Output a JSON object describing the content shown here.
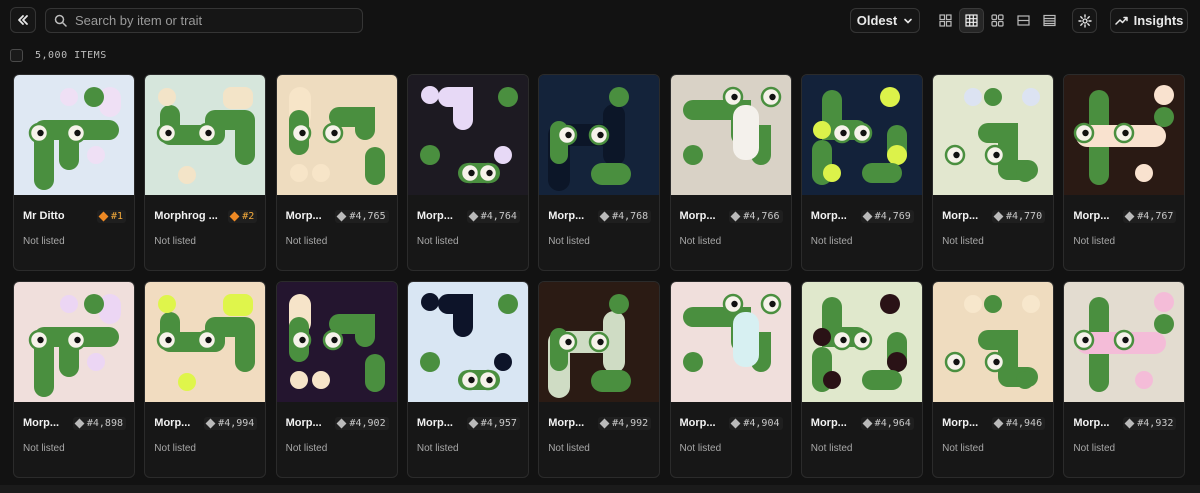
{
  "toolbar": {
    "search_placeholder": "Search by item or trait",
    "sort_label": "Oldest",
    "insights_label": "Insights",
    "view_modes": [
      "grid-small-icon",
      "grid-medium-icon",
      "grid-large-icon",
      "list-icon",
      "table-icon"
    ],
    "active_view": 1
  },
  "item_count": "5,000 ITEMS",
  "colors": {
    "accent_orange": "#f08a24",
    "frog_green": "#4a8f3f",
    "background": "#121212"
  },
  "items": [
    {
      "name": "Mr Ditto",
      "rank": "#1",
      "status": "Not listed",
      "top": true,
      "bg": "#dfe8f3",
      "accent": "#efe0f5"
    },
    {
      "name": "Morphrog ...",
      "rank": "#2",
      "status": "Not listed",
      "top": true,
      "bg": "#d6e6dc",
      "accent": "#f3e4c8"
    },
    {
      "name": "Morp...",
      "rank": "#4,765",
      "status": "Not listed",
      "bg": "#eedcbf",
      "accent": "#f7e5c8"
    },
    {
      "name": "Morp...",
      "rank": "#4,764",
      "status": "Not listed",
      "bg": "#1d1a22",
      "accent": "#e7d9f6"
    },
    {
      "name": "Morp...",
      "rank": "#4,768",
      "status": "Not listed",
      "bg": "#14233a",
      "accent": "#0c1628"
    },
    {
      "name": "Morp...",
      "rank": "#4,766",
      "status": "Not listed",
      "bg": "#d9d2c6",
      "accent": "#f4f1ec"
    },
    {
      "name": "Morp...",
      "rank": "#4,769",
      "status": "Not listed",
      "bg": "#13223a",
      "accent": "#dcf24a"
    },
    {
      "name": "Morp...",
      "rank": "#4,770",
      "status": "Not listed",
      "bg": "#e2e7cf",
      "accent": "#dce3f2"
    },
    {
      "name": "Morp...",
      "rank": "#4,767",
      "status": "Not listed",
      "bg": "#2a1a14",
      "accent": "#f9e2cf"
    },
    {
      "name": "Morp...",
      "rank": "#4,898",
      "status": "Not listed",
      "bg": "#f0dfdc",
      "accent": "#ecd6f4"
    },
    {
      "name": "Morp...",
      "rank": "#4,994",
      "status": "Not listed",
      "bg": "#f1dcc0",
      "accent": "#dff54b"
    },
    {
      "name": "Morp...",
      "rank": "#4,902",
      "status": "Not listed",
      "bg": "#24152f",
      "accent": "#f6e4c9"
    },
    {
      "name": "Morp...",
      "rank": "#4,957",
      "status": "Not listed",
      "bg": "#d9e6f3",
      "accent": "#0d1429"
    },
    {
      "name": "Morp...",
      "rank": "#4,992",
      "status": "Not listed",
      "bg": "#2b1b14",
      "accent": "#cfdcc4"
    },
    {
      "name": "Morp...",
      "rank": "#4,904",
      "status": "Not listed",
      "bg": "#f0dfdc",
      "accent": "#d7f0f2"
    },
    {
      "name": "Morp...",
      "rank": "#4,964",
      "status": "Not listed",
      "bg": "#e0e8cc",
      "accent": "#2a1216"
    },
    {
      "name": "Morp...",
      "rank": "#4,946",
      "status": "Not listed",
      "bg": "#efdcbf",
      "accent": "#f7e7cc"
    },
    {
      "name": "Morp...",
      "rank": "#4,932",
      "status": "Not listed",
      "bg": "#e3dcd0",
      "accent": "#f4bcd8"
    }
  ]
}
